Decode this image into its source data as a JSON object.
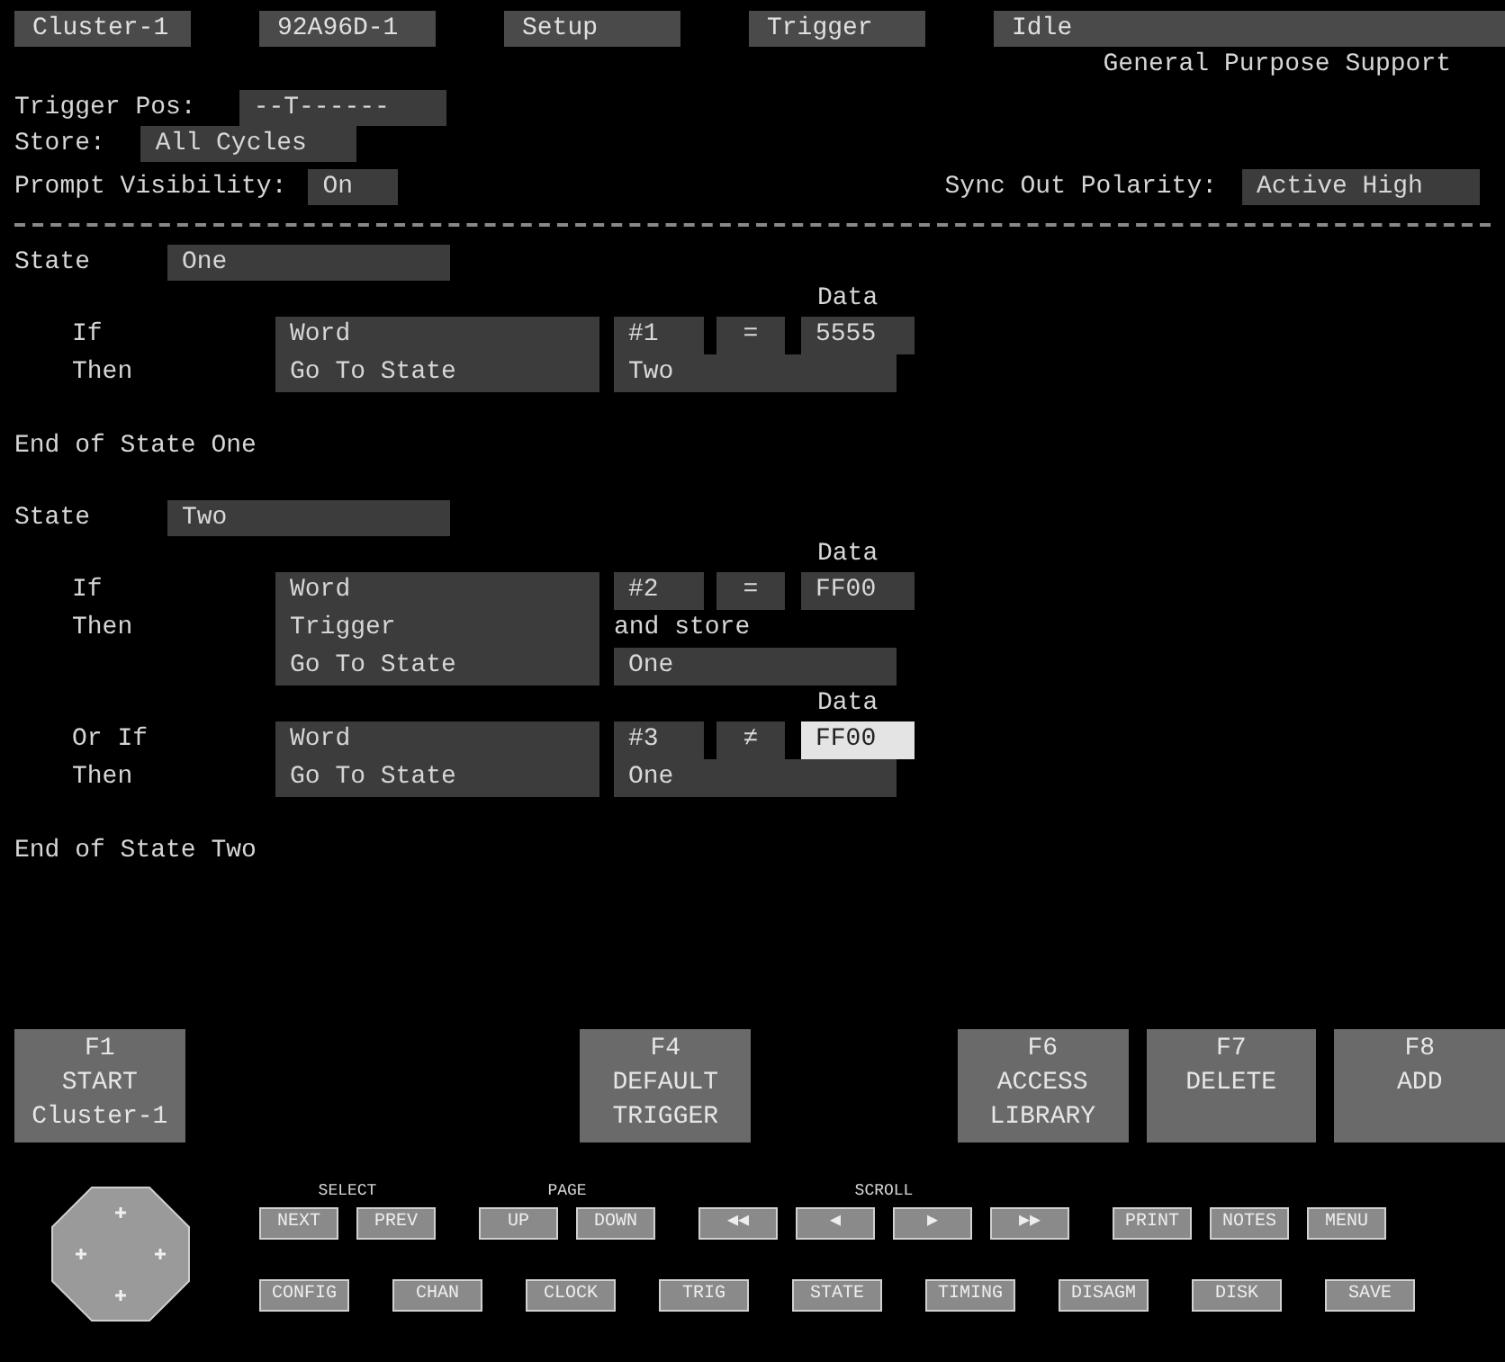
{
  "header": {
    "cells": [
      "Cluster-1",
      "92A96D-1",
      "Setup",
      "Trigger",
      "Idle"
    ],
    "subtitle": "General Purpose Support"
  },
  "settings": {
    "trigger_pos": {
      "label": "Trigger Pos:",
      "value": "--T------"
    },
    "store": {
      "label": "Store:",
      "value": "All Cycles"
    },
    "prompt_visibility": {
      "label": "Prompt Visibility:",
      "value": "On"
    },
    "sync_out_polarity": {
      "label": "Sync Out Polarity:",
      "value": "Active High"
    }
  },
  "states": [
    {
      "label": "State",
      "name": "One",
      "clauses": [
        {
          "label": "If",
          "event": "Word",
          "pattern": "#1",
          "operator": "=",
          "data_label": "Data",
          "data": "5555",
          "data_selected": false,
          "actions": [
            {
              "label": "Then",
              "action": "Go To State",
              "kind": "field",
              "target": "Two"
            }
          ]
        }
      ],
      "end": "End of State One"
    },
    {
      "label": "State",
      "name": "Two",
      "clauses": [
        {
          "label": "If",
          "event": "Word",
          "pattern": "#2",
          "operator": "=",
          "data_label": "Data",
          "data": "FF00",
          "data_selected": false,
          "actions": [
            {
              "label": "Then",
              "action": "Trigger",
              "kind": "note",
              "target": "and store"
            },
            {
              "action": "Go To State",
              "kind": "field",
              "target": "One"
            }
          ]
        },
        {
          "label": "Or If",
          "event": "Word",
          "pattern": "#3",
          "operator": "≠",
          "data_label": "Data",
          "data": "FF00",
          "data_selected": true,
          "actions": [
            {
              "label": "Then",
              "action": "Go To State",
              "kind": "field",
              "target": "One"
            }
          ]
        }
      ],
      "end": "End of State Two"
    }
  ],
  "function_keys": [
    {
      "kind": "key",
      "lines": [
        "F1",
        "START",
        "Cluster-1"
      ]
    },
    {
      "kind": "blank"
    },
    {
      "kind": "blank"
    },
    {
      "kind": "key",
      "lines": [
        "F4",
        "DEFAULT",
        "TRIGGER"
      ]
    },
    {
      "kind": "blank"
    },
    {
      "kind": "key",
      "lines": [
        "F6",
        "ACCESS",
        "LIBRARY"
      ]
    },
    {
      "kind": "key",
      "lines": [
        "F7",
        "DELETE"
      ]
    },
    {
      "kind": "key",
      "lines": [
        "F8",
        "ADD"
      ]
    }
  ],
  "keypad": {
    "groups": [
      {
        "label": "SELECT",
        "buttons": [
          "NEXT",
          "PREV"
        ]
      },
      {
        "label": "PAGE",
        "buttons": [
          "UP",
          "DOWN"
        ]
      },
      {
        "label": "SCROLL",
        "buttons": [
          "◀◀",
          "◀",
          "▶",
          "▶▶"
        ]
      },
      {
        "buttons": [
          "PRINT",
          "NOTES",
          "MENU"
        ]
      }
    ],
    "row2": [
      "CONFIG",
      "CHAN",
      "CLOCK",
      "TRIG",
      "STATE",
      "TIMING",
      "DISAGM",
      "DISK",
      "SAVE"
    ]
  }
}
